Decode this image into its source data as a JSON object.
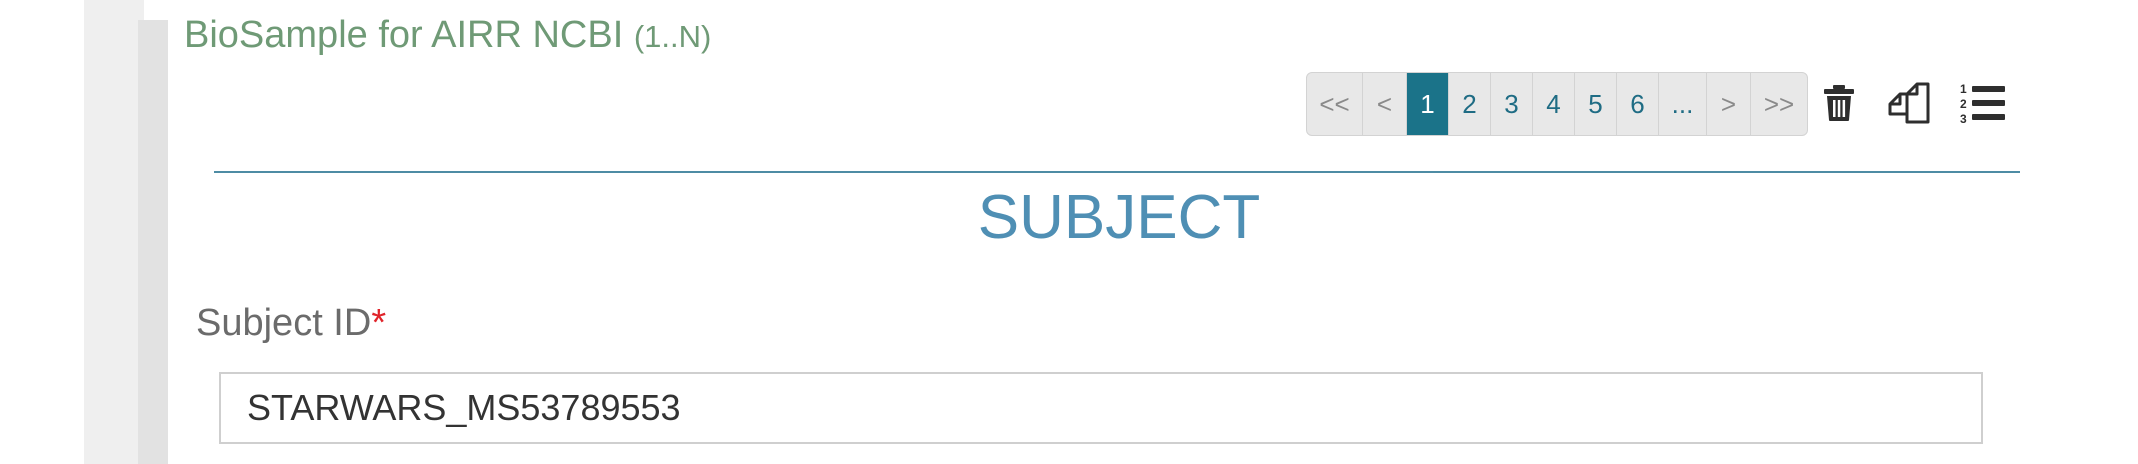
{
  "section": {
    "title": "BioSample for AIRR NCBI",
    "cardinality": "(1..N)"
  },
  "pagination": {
    "first_label": "<<",
    "prev_label": "<",
    "pages": [
      "1",
      "2",
      "3",
      "4",
      "5",
      "6"
    ],
    "current_page": "1",
    "ellipsis_label": "...",
    "next_label": ">",
    "last_label": ">>"
  },
  "toolbar": {
    "icons": [
      "trash-icon",
      "copy-icon",
      "ordered-list-icon"
    ]
  },
  "colors": {
    "title_green": "#6f9a76",
    "heading_blue": "#4f8fb4",
    "active_page": "#1b7389",
    "required_red": "#e0242b"
  },
  "subject": {
    "heading": "SUBJECT",
    "field_label": "Subject ID",
    "required_marker": "*",
    "value": "STARWARS_MS53789553"
  }
}
